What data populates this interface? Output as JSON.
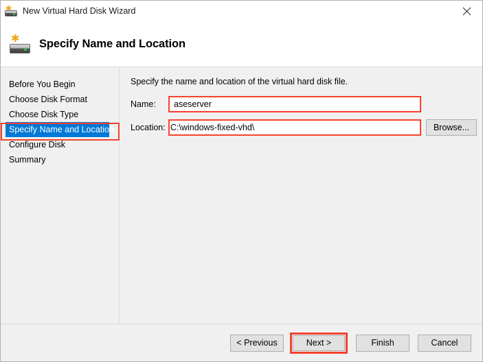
{
  "window": {
    "title": "New Virtual Hard Disk Wizard",
    "title_icon": "new-virtual-hard-disk-icon",
    "close_label": "✕"
  },
  "header": {
    "icon": "new-virtual-hard-disk-icon",
    "title": "Specify Name and Location"
  },
  "sidebar": {
    "items": [
      {
        "label": "Before You Begin",
        "selected": false
      },
      {
        "label": "Choose Disk Format",
        "selected": false
      },
      {
        "label": "Choose Disk Type",
        "selected": false
      },
      {
        "label": "Specify Name and Location",
        "selected": true
      },
      {
        "label": "Configure Disk",
        "selected": false
      },
      {
        "label": "Summary",
        "selected": false
      }
    ]
  },
  "main": {
    "intro": "Specify the name and location of the virtual hard disk file.",
    "fields": {
      "name": {
        "label": "Name:",
        "value": "aseserver",
        "placeholder": ""
      },
      "location": {
        "label": "Location:",
        "value": "C:\\windows-fixed-vhd\\",
        "placeholder": ""
      }
    },
    "browse_label": "Browse..."
  },
  "footer": {
    "previous_label": "< Previous",
    "next_label": "Next >",
    "finish_label": "Finish",
    "cancel_label": "Cancel"
  },
  "colors": {
    "selection_blue": "#0078D7",
    "annotation_red": "#F5422E",
    "window_background": "#F0F0F0",
    "button_face": "#E1E1E1"
  }
}
